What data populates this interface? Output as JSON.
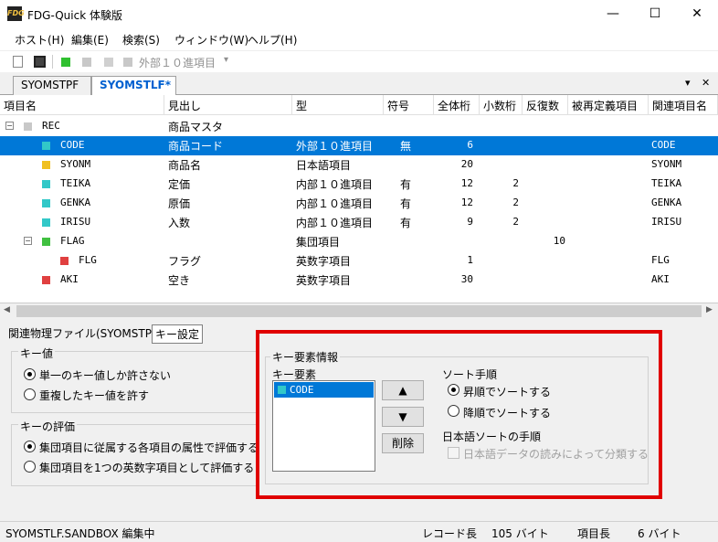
{
  "window": {
    "title": "FDG-Quick 体験版",
    "icon": "fdg-app-icon",
    "minimize": "—",
    "maximize": "☐",
    "close": "✕"
  },
  "menu": [
    "ホスト(H)",
    "編集(E)",
    "検索(S)",
    "ウィンドウ(W)",
    "ヘルプ(H)"
  ],
  "toolbar": {
    "type_select": "外部１０進項目",
    "dropdown_glyph": "▾"
  },
  "tabs": [
    {
      "label": "SYOMSTPF",
      "active": false
    },
    {
      "label": "SYOMSTLF*",
      "active": true
    }
  ],
  "tab_controls": {
    "dropdown": "▾",
    "close": "✕"
  },
  "grid": {
    "columns": [
      "項目名",
      "見出し",
      "型",
      "符号",
      "全体桁",
      "小数桁",
      "反復数",
      "被再定義項目",
      "関連項目名"
    ],
    "rows": [
      {
        "name": "REC",
        "heading": "商品マスタ",
        "type": "",
        "sign": "",
        "total": "",
        "decimal": "",
        "repeat": "",
        "redef": "",
        "related": "",
        "color": "#c8c8c8",
        "level": 0,
        "expander": "⊟"
      },
      {
        "name": "CODE",
        "heading": "商品コード",
        "type": "外部１０進項目",
        "sign": "無",
        "total": "6",
        "decimal": "",
        "repeat": "",
        "redef": "",
        "related": "CODE",
        "color": "#32c8c8",
        "level": 1,
        "selected": true
      },
      {
        "name": "SYONM",
        "heading": "商品名",
        "type": "日本語項目",
        "sign": "",
        "total": "20",
        "decimal": "",
        "repeat": "",
        "redef": "",
        "related": "SYONM",
        "color": "#f0c020",
        "level": 1
      },
      {
        "name": "TEIKA",
        "heading": "定価",
        "type": "内部１０進項目",
        "sign": "有",
        "total": "12",
        "decimal": "2",
        "repeat": "",
        "redef": "",
        "related": "TEIKA",
        "color": "#32c8c8",
        "level": 1
      },
      {
        "name": "GENKA",
        "heading": "原価",
        "type": "内部１０進項目",
        "sign": "有",
        "total": "12",
        "decimal": "2",
        "repeat": "",
        "redef": "",
        "related": "GENKA",
        "color": "#32c8c8",
        "level": 1
      },
      {
        "name": "IRISU",
        "heading": "入数",
        "type": "内部１０進項目",
        "sign": "有",
        "total": "9",
        "decimal": "2",
        "repeat": "",
        "redef": "",
        "related": "IRISU",
        "color": "#32c8c8",
        "level": 1
      },
      {
        "name": "FLAG",
        "heading": "",
        "type": "集団項目",
        "sign": "",
        "total": "",
        "decimal": "",
        "repeat": "10",
        "redef": "",
        "related": "",
        "color": "#40c040",
        "level": 1,
        "expander": "⊟"
      },
      {
        "name": "FLG",
        "heading": "フラグ",
        "type": "英数字項目",
        "sign": "",
        "total": "1",
        "decimal": "",
        "repeat": "",
        "redef": "",
        "related": "FLG",
        "color": "#e04040",
        "level": 2
      },
      {
        "name": "AKI",
        "heading": "空き",
        "type": "英数字項目",
        "sign": "",
        "total": "30",
        "decimal": "",
        "repeat": "",
        "redef": "",
        "related": "AKI",
        "color": "#e04040",
        "level": 1
      }
    ]
  },
  "lower": {
    "tabs": [
      "関連物理ファイル(SYOMSTPF)",
      "キー設定"
    ],
    "key_value": {
      "title": "キー値",
      "options": [
        "単一のキー値しか許さない",
        "重複したキー値を許す"
      ],
      "selected": 0
    },
    "key_eval": {
      "title": "キーの評価",
      "options": [
        "集団項目に従属する各項目の属性で評価する",
        "集団項目を1つの英数字項目として評価する"
      ],
      "selected": 0
    },
    "key_elem_info": {
      "title": "キー要素情報",
      "list_label": "キー要素",
      "items": [
        "CODE"
      ],
      "up": "▲",
      "down": "▼",
      "delete": "削除",
      "sort_title": "ソート手順",
      "sort_options": [
        "昇順でソートする",
        "降順でソートする"
      ],
      "sort_selected": 0,
      "jp_sort_title": "日本語ソートの手順",
      "jp_sort_checkbox": "日本語データの読みによって分類する"
    }
  },
  "status": {
    "left": "SYOMSTLF.SANDBOX 編集中",
    "record_len_label": "レコード長",
    "record_len_value": "105 バイト",
    "item_len_label": "項目長",
    "item_len_value": "6 バイト"
  }
}
